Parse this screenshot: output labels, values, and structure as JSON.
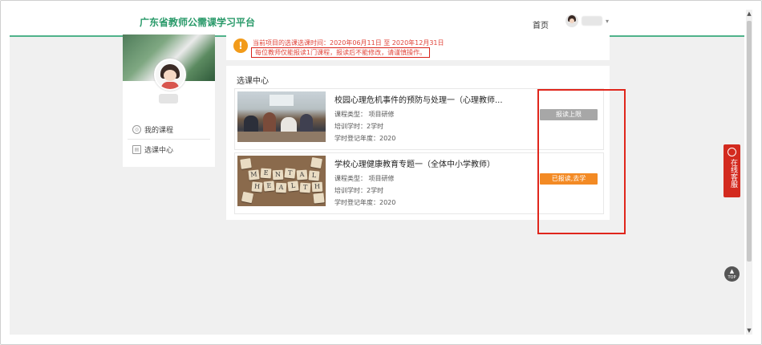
{
  "header": {
    "brand": "广东省教师公需课学习平台",
    "home_link": "首页"
  },
  "sidebar": {
    "items": [
      {
        "label": "我的课程",
        "icon": "my-course-icon"
      },
      {
        "label": "选课中心",
        "icon": "course-center-icon"
      }
    ]
  },
  "notice": {
    "line1": "当前项目的选课选课时间：2020年06月11日 至 2020年12月31日",
    "line2": "每位教师仅能报读1门课程，报读后不能修改，请谨慎操作。"
  },
  "panel": {
    "title": "选课中心",
    "courses": [
      {
        "title": "校园心理危机事件的预防与处理一（心理教师...",
        "type": "课程类型： 项目研修",
        "hours": "培训学时：2学时",
        "year": "学时登记年度：2020",
        "button": "报读上限"
      },
      {
        "title": "学校心理健康教育专题一（全体中小学教师）",
        "type": "课程类型： 项目研修",
        "hours": "培训学时：2学时",
        "year": "学时登记年度：2020",
        "button": "已报读,去学"
      }
    ]
  },
  "thumb_tiles": {
    "row1": [
      "M",
      "E",
      "N",
      "T",
      "A",
      "L"
    ],
    "row2": [
      "H",
      "E",
      "A",
      "L",
      "T",
      "H"
    ]
  },
  "service": {
    "label": "在线客服"
  },
  "totop": {
    "label": "TOP"
  },
  "colors": {
    "brand_green": "#2a9a6a",
    "alert_red": "#e0443a",
    "button_gray": "#a7a7a7",
    "button_orange": "#f38a24",
    "service_red": "#d32a1f"
  }
}
